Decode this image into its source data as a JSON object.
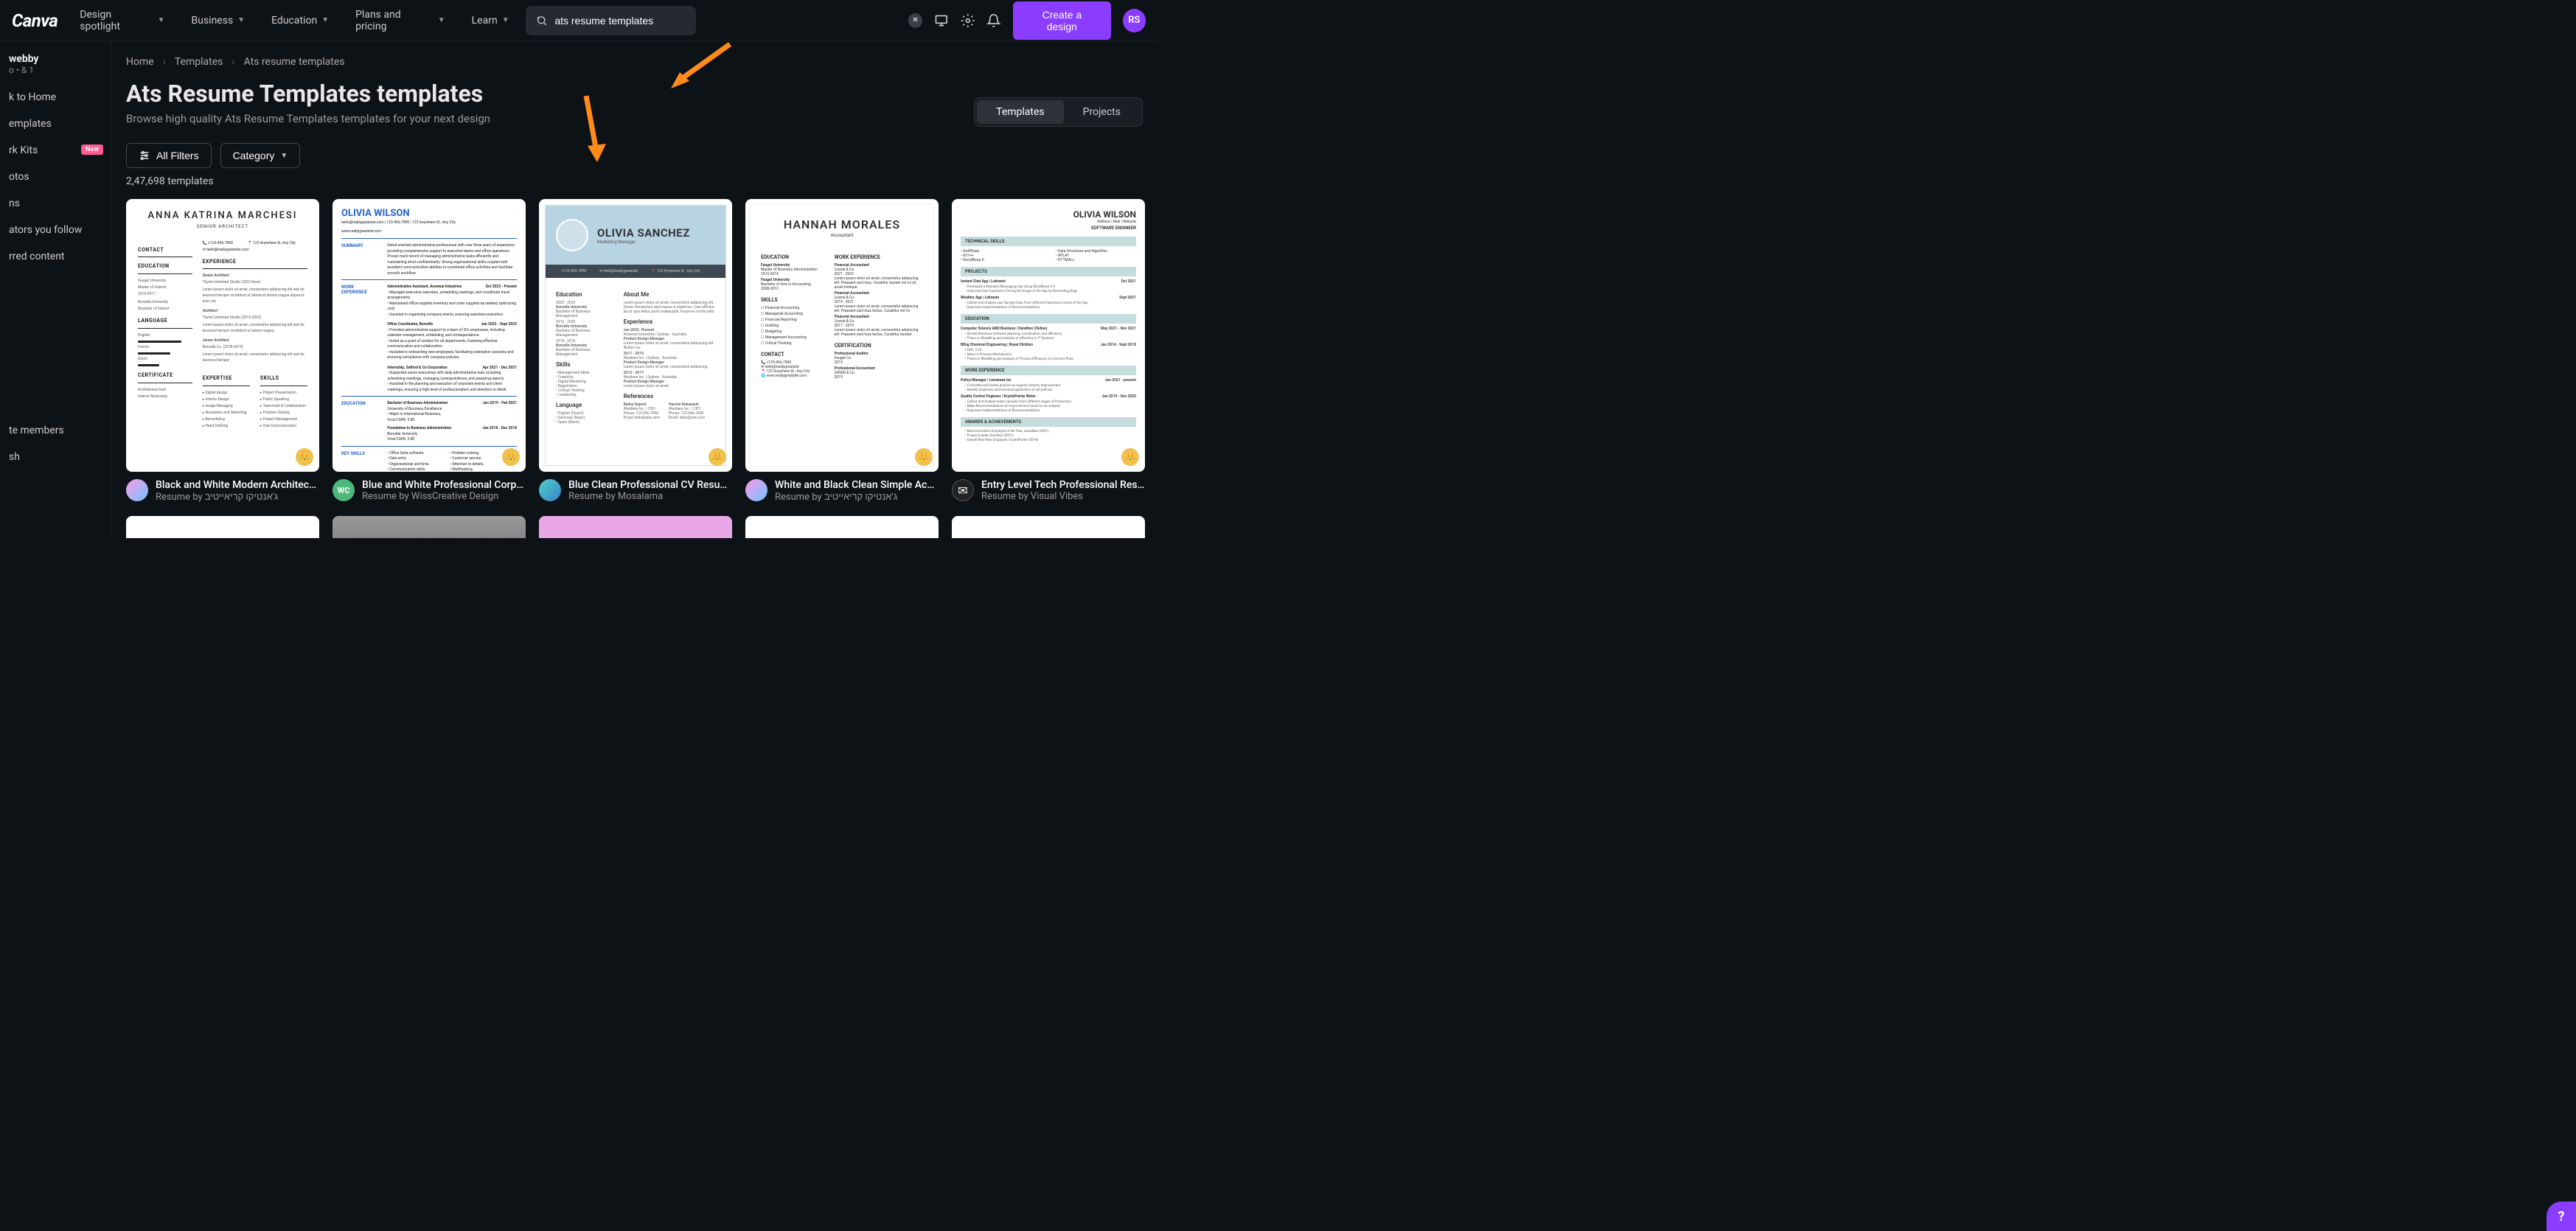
{
  "logo": "Canva",
  "nav": [
    {
      "label": "Design spotlight"
    },
    {
      "label": "Business"
    },
    {
      "label": "Education"
    },
    {
      "label": "Plans and pricing"
    },
    {
      "label": "Learn"
    }
  ],
  "search": {
    "value": "ats resume templates"
  },
  "create_label": "Create a design",
  "user_initials": "RS",
  "sidebar": {
    "user_name": "webby",
    "user_sub": "o • & 1",
    "items": [
      {
        "label": "k to Home"
      },
      {
        "label": "emplates"
      },
      {
        "label": "rk Kits",
        "badge": "New"
      },
      {
        "label": "otos"
      },
      {
        "label": "ns"
      },
      {
        "label": "ators you follow"
      },
      {
        "label": "rred content"
      },
      {
        "label": "te members"
      },
      {
        "label": "sh"
      }
    ]
  },
  "breadcrumbs": [
    "Home",
    "Templates",
    "Ats resume templates"
  ],
  "page_title": "Ats Resume Templates templates",
  "page_subtitle": "Browse high quality Ats Resume Templates templates for your next design",
  "toggle": {
    "templates": "Templates",
    "projects": "Projects"
  },
  "filters": {
    "all": "All Filters",
    "category": "Category"
  },
  "count": "2,47,698 templates",
  "cards": [
    {
      "title": "Black and White Modern Architect ...",
      "sub": "Resume by ג'אנטיקו קריאייטיב",
      "avatar_bg": "linear-gradient(135deg,#ff9ae8,#6ec3ff)",
      "crown": true
    },
    {
      "title": "Blue and White Professional Corpo...",
      "sub": "Resume by WissCreative Design",
      "avatar_bg": "#4db879",
      "avatar_text": "WC",
      "crown": true
    },
    {
      "title": "Blue Clean Professional CV Resume",
      "sub": "Resume by Mosalama",
      "avatar_bg": "linear-gradient(135deg,#4dd0c9,#3b82c7)",
      "crown": true
    },
    {
      "title": "White and Black Clean Simple Acco...",
      "sub": "Resume by ג'אנטיקו קריאייטיב",
      "avatar_bg": "linear-gradient(135deg,#ff9ae8,#6ec3ff)",
      "crown": true
    },
    {
      "title": "Entry Level Tech Professional Resu...",
      "sub": "Resume by Visual Vibes",
      "avatar_bg": "#222",
      "avatar_icon": "✉",
      "crown": true
    }
  ],
  "resumes": {
    "r1": {
      "name": "ANNA KATRINA MARCHESI",
      "role": "SENIOR ARCHITECT",
      "sections": {
        "contact": "CONTACT",
        "education": "EDUCATION",
        "language": "LANGUAGE",
        "certificate": "CERTIFICATE",
        "experience": "EXPERIENCE",
        "expertise": "EXPERTISE",
        "skills": "SKILLS"
      }
    },
    "r2": {
      "name": "OLIVIA WILSON",
      "sections": {
        "summary": "SUMMARY",
        "work": "WORK EXPERIENCE",
        "education": "EDUCATION",
        "skills": "KEY SKILLS"
      }
    },
    "r3": {
      "name": "OLIVIA SANCHEZ",
      "role": "Marketing Manager",
      "sections": {
        "edu": "Education",
        "about": "About Me",
        "exp": "Experience",
        "skills": "Skills",
        "lang": "Language",
        "refs": "References"
      }
    },
    "r4": {
      "name": "HANNAH MORALES",
      "role": "Accountant",
      "sections": {
        "edu": "EDUCATION",
        "work": "WORK EXPERIENCE",
        "skills": "SKILLS",
        "contact": "CONTACT",
        "cert": "CERTIFICATION"
      }
    },
    "r5": {
      "name": "OLIVIA WILSON",
      "sub": "Address | Mail | Website",
      "role": "SOFTWARE ENGINEER",
      "sections": {
        "tech": "TECHNICAL SKILLS",
        "proj": "PROJECTS",
        "edu": "EDUCATION",
        "work": "WORK EXPERIENCE",
        "awards": "AWARDS & ACHIEVEMENTS"
      }
    }
  }
}
